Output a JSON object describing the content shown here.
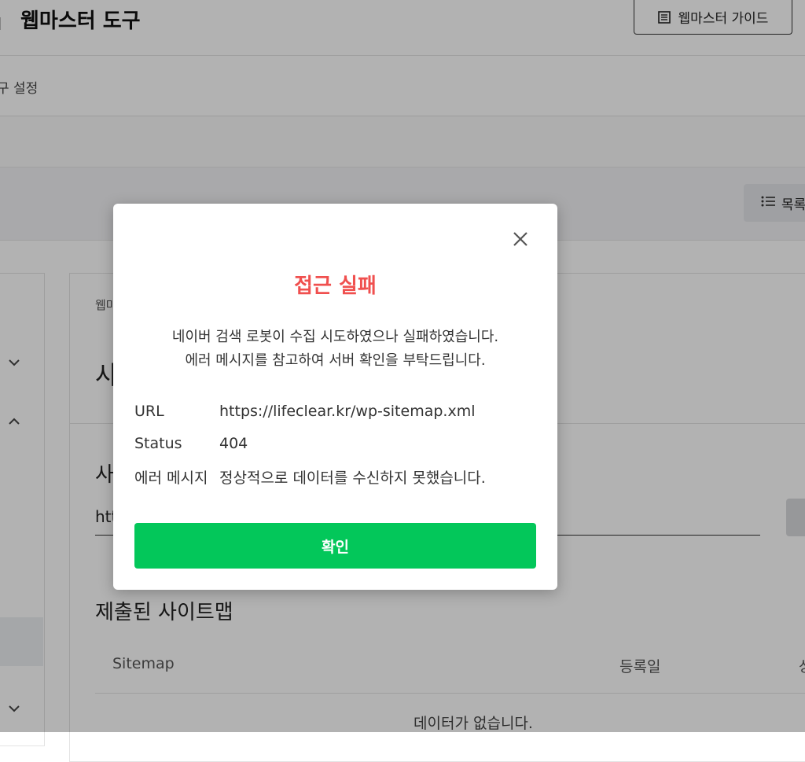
{
  "header": {
    "title": "웹마스터 도구",
    "guide_button_label": "웹마스터 가이드"
  },
  "subnav": {
    "item_label": "구 설정"
  },
  "toolbar": {
    "list_button_label": "목록"
  },
  "main": {
    "breadcrumb": "웹마",
    "heading": "사",
    "section_heading": "사",
    "url_input_value": "htt",
    "submitted_heading": "제출된 사이트맵",
    "table": {
      "columns": [
        "Sitemap",
        "등록일",
        "상"
      ],
      "empty_text": "데이터가 없습니다."
    }
  },
  "modal": {
    "title": "접근 실패",
    "description_line1": "네이버 검색 로봇이 수집 시도하였으나 실패하였습니다.",
    "description_line2": "에러 메시지를 참고하여 서버 확인을 부탁드립니다.",
    "rows": [
      {
        "label": "URL",
        "value": "https://lifeclear.kr/wp-sitemap.xml"
      },
      {
        "label": "Status",
        "value": "404"
      },
      {
        "label": "에러 메시지",
        "value": "정상적으로 데이터를 수신하지 못했습니다."
      }
    ],
    "confirm_label": "확인"
  },
  "colors": {
    "title_red": "#f0504f",
    "confirm_green": "#03c75a"
  }
}
